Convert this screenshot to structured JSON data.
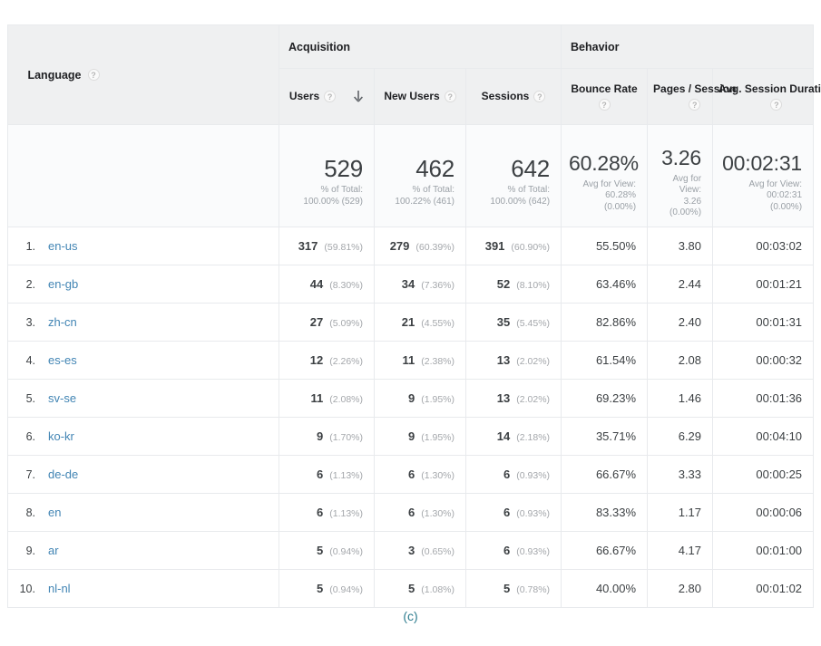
{
  "table": {
    "dimension_header": {
      "label": "Language",
      "help": "?"
    },
    "groups": [
      {
        "name": "Acquisition"
      },
      {
        "name": "Behavior"
      }
    ],
    "columns": [
      {
        "key": "users",
        "label": "Users",
        "help": "?",
        "sorted": true,
        "sort_dir": "desc"
      },
      {
        "key": "new_users",
        "label": "New Users",
        "help": "?"
      },
      {
        "key": "sessions",
        "label": "Sessions",
        "help": "?"
      },
      {
        "key": "bounce",
        "label": "Bounce Rate",
        "help": "?"
      },
      {
        "key": "pages",
        "label": "Pages / Session",
        "help": "?"
      },
      {
        "key": "duration",
        "label": "Avg. Session Duration",
        "help": "?"
      }
    ],
    "summary": {
      "users": {
        "value": "529",
        "line1": "% of Total:",
        "line2": "100.00% (529)"
      },
      "new_users": {
        "value": "462",
        "line1": "% of Total:",
        "line2": "100.22% (461)"
      },
      "sessions": {
        "value": "642",
        "line1": "% of Total:",
        "line2": "100.00% (642)"
      },
      "bounce": {
        "value": "60.28%",
        "line1": "Avg for View:",
        "line2": "60.28%",
        "line3": "(0.00%)"
      },
      "pages": {
        "value": "3.26",
        "line1": "Avg for",
        "line2": "View:",
        "line3": "3.26",
        "line4": "(0.00%)"
      },
      "duration": {
        "value": "00:02:31",
        "line1": "Avg for View:",
        "line2": "00:02:31",
        "line3": "(0.00%)"
      }
    },
    "rows": [
      {
        "rank": "1.",
        "language": "en-us",
        "users": "317",
        "users_pct": "(59.81%)",
        "new_users": "279",
        "new_users_pct": "(60.39%)",
        "sessions": "391",
        "sessions_pct": "(60.90%)",
        "bounce": "55.50%",
        "pages": "3.80",
        "duration": "00:03:02"
      },
      {
        "rank": "2.",
        "language": "en-gb",
        "users": "44",
        "users_pct": "(8.30%)",
        "new_users": "34",
        "new_users_pct": "(7.36%)",
        "sessions": "52",
        "sessions_pct": "(8.10%)",
        "bounce": "63.46%",
        "pages": "2.44",
        "duration": "00:01:21"
      },
      {
        "rank": "3.",
        "language": "zh-cn",
        "users": "27",
        "users_pct": "(5.09%)",
        "new_users": "21",
        "new_users_pct": "(4.55%)",
        "sessions": "35",
        "sessions_pct": "(5.45%)",
        "bounce": "82.86%",
        "pages": "2.40",
        "duration": "00:01:31"
      },
      {
        "rank": "4.",
        "language": "es-es",
        "users": "12",
        "users_pct": "(2.26%)",
        "new_users": "11",
        "new_users_pct": "(2.38%)",
        "sessions": "13",
        "sessions_pct": "(2.02%)",
        "bounce": "61.54%",
        "pages": "2.08",
        "duration": "00:00:32"
      },
      {
        "rank": "5.",
        "language": "sv-se",
        "users": "11",
        "users_pct": "(2.08%)",
        "new_users": "9",
        "new_users_pct": "(1.95%)",
        "sessions": "13",
        "sessions_pct": "(2.02%)",
        "bounce": "69.23%",
        "pages": "1.46",
        "duration": "00:01:36"
      },
      {
        "rank": "6.",
        "language": "ko-kr",
        "users": "9",
        "users_pct": "(1.70%)",
        "new_users": "9",
        "new_users_pct": "(1.95%)",
        "sessions": "14",
        "sessions_pct": "(2.18%)",
        "bounce": "35.71%",
        "pages": "6.29",
        "duration": "00:04:10"
      },
      {
        "rank": "7.",
        "language": "de-de",
        "users": "6",
        "users_pct": "(1.13%)",
        "new_users": "6",
        "new_users_pct": "(1.30%)",
        "sessions": "6",
        "sessions_pct": "(0.93%)",
        "bounce": "66.67%",
        "pages": "3.33",
        "duration": "00:00:25"
      },
      {
        "rank": "8.",
        "language": "en",
        "users": "6",
        "users_pct": "(1.13%)",
        "new_users": "6",
        "new_users_pct": "(1.30%)",
        "sessions": "6",
        "sessions_pct": "(0.93%)",
        "bounce": "83.33%",
        "pages": "1.17",
        "duration": "00:00:06"
      },
      {
        "rank": "9.",
        "language": "ar",
        "users": "5",
        "users_pct": "(0.94%)",
        "new_users": "3",
        "new_users_pct": "(0.65%)",
        "sessions": "6",
        "sessions_pct": "(0.93%)",
        "bounce": "66.67%",
        "pages": "4.17",
        "duration": "00:01:00"
      },
      {
        "rank": "10.",
        "language": "nl-nl",
        "users": "5",
        "users_pct": "(0.94%)",
        "new_users": "5",
        "new_users_pct": "(1.08%)",
        "sessions": "5",
        "sessions_pct": "(0.78%)",
        "bounce": "40.00%",
        "pages": "2.80",
        "duration": "00:01:02"
      }
    ]
  },
  "caption": {
    "text": "(c)",
    "color": "#2e7d8f"
  }
}
